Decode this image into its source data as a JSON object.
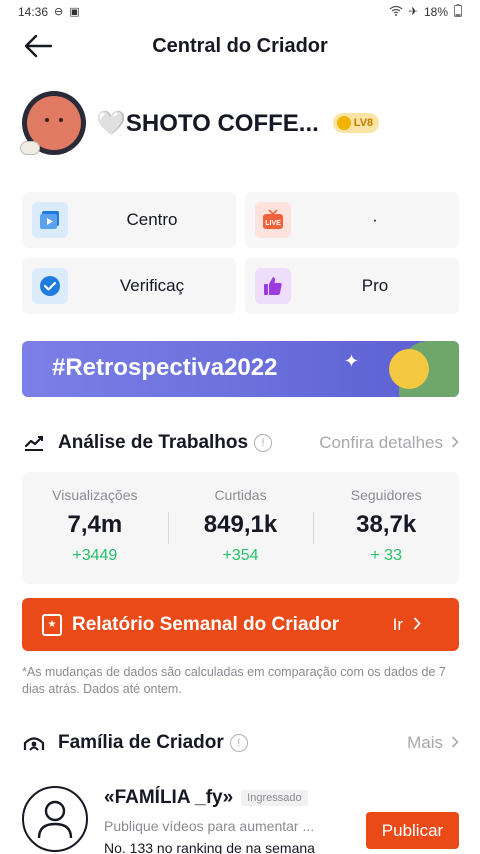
{
  "status_bar": {
    "time": "14:36",
    "battery": "18%",
    "icons": [
      "do-not-disturb-icon",
      "notification-icon",
      "wifi-icon",
      "airplane-icon",
      "battery-icon"
    ]
  },
  "header": {
    "title": "Central do Criador",
    "back_icon": "arrow-left-icon"
  },
  "profile": {
    "username": "🤍SHOTO COFFE...",
    "level": "LV8"
  },
  "tools": [
    {
      "label": "Centro",
      "icon": "video-play-icon",
      "color": "#1f7be0"
    },
    {
      "label": "·",
      "icon": "live-icon",
      "color": "#f0623a"
    },
    {
      "label": "Verificaç",
      "icon": "check-badge-icon",
      "color": "#1f7be0"
    },
    {
      "label": "Pro",
      "icon": "thumbs-up-icon",
      "color": "#9b3be0"
    }
  ],
  "banner": {
    "text": "#Retrospectiva2022"
  },
  "analysis": {
    "title": "Análise de Trabalhos",
    "link": "Confira detalhes",
    "stats": [
      {
        "label": "Visualizações",
        "value": "7,4m",
        "delta": "+3449"
      },
      {
        "label": "Curtidas",
        "value": "849,1k",
        "delta": "+354"
      },
      {
        "label": "Seguidores",
        "value": "38,7k",
        "delta": "+ 33"
      }
    ]
  },
  "report": {
    "label": "Relatório Semanal do Criador",
    "action": "Ir"
  },
  "note": "*As mudanças de dados são calculadas em comparação com os dados de 7 dias atrás. Dados até ontem.",
  "family_section": {
    "title": "Família de Criador",
    "link": "Mais",
    "name": "«FAMÍLIA _fy»",
    "tag": "Ingressado",
    "description": "Publique vídeos para aumentar ...",
    "rank": "No. 133 no ranking de na semana",
    "action": "Publicar"
  },
  "colors": {
    "accent": "#ea4a17",
    "positive": "#25c26a",
    "muted": "#8a8b91"
  }
}
